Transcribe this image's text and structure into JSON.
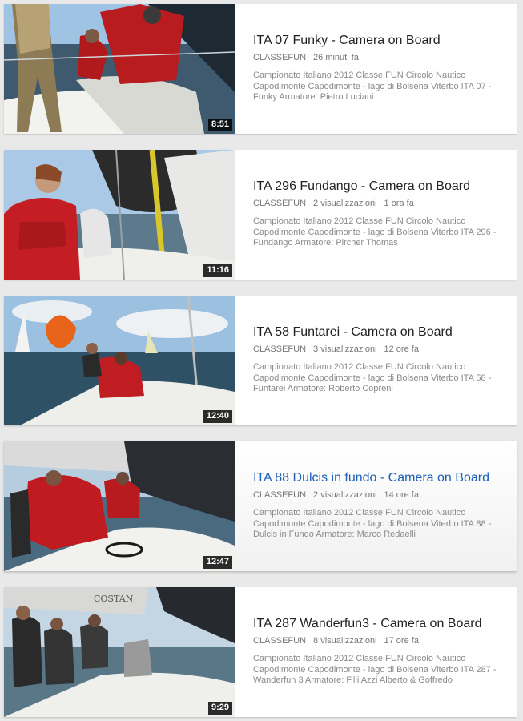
{
  "videos": [
    {
      "title": "ITA 07 Funky - Camera on Board",
      "channel": "CLASSEFUN",
      "views": "",
      "age": "26 minuti fa",
      "description": "Campionato Italiano 2012 Classe FUN Circolo Nautico Capodimonte Capodimonte - lago di Bolsena Viterbo ITA 07 - Funky Armatore: Pietro Luciani",
      "duration": "8:51"
    },
    {
      "title": "ITA 296 Fundango - Camera on Board",
      "channel": "CLASSEFUN",
      "views": "2 visualizzazioni",
      "age": "1 ora fa",
      "description": "Campionato Italiano 2012 Classe FUN Circolo Nautico Capodimonte Capodimonte - lago di Bolsena Viterbo ITA 296 - Fundango Armatore: Pircher Thomas",
      "duration": "11:16"
    },
    {
      "title": "ITA 58 Funtarei - Camera on Board",
      "channel": "CLASSEFUN",
      "views": "3 visualizzazioni",
      "age": "12 ore fa",
      "description": "Campionato Italiano 2012 Classe FUN Circolo Nautico Capodimonte Capodimonte - lago di Bolsena Viterbo ITA 58 - Funtarei Armatore: Roberto Copreni",
      "duration": "12:40"
    },
    {
      "title": "ITA 88 Dulcis in fundo - Camera on Board",
      "channel": "CLASSEFUN",
      "views": "2 visualizzazioni",
      "age": "14 ore fa",
      "description": "Campionato Italiano 2012 Classe FUN Circolo Nautico Capodimonte Capodimonte - lago di Bolsena Viterbo ITA 88 - Dulcis in Fundo Armatore: Marco Redaelli",
      "duration": "12:47"
    },
    {
      "title": "ITA 287 Wanderfun3 - Camera on Board",
      "channel": "CLASSEFUN",
      "views": "8 visualizzazioni",
      "age": "17 ore fa",
      "description": "Campionato Italiano 2012 Classe FUN Circolo Nautico Capodimonte Capodimonte - lago di Bolsena Viterbo ITA 287 - Wanderfun 3 Armatore: F.lli Azzi Alberto & Goffredo",
      "duration": "9:29"
    }
  ],
  "thumb_watermarks": [
    "COSTAN"
  ],
  "colors": {
    "page_bg": "#e9e9e9",
    "card_bg": "#ffffff",
    "title_text": "#222222",
    "title_hover": "#1b5fb8",
    "meta_text": "#767676",
    "duration_bg": "#000000"
  }
}
